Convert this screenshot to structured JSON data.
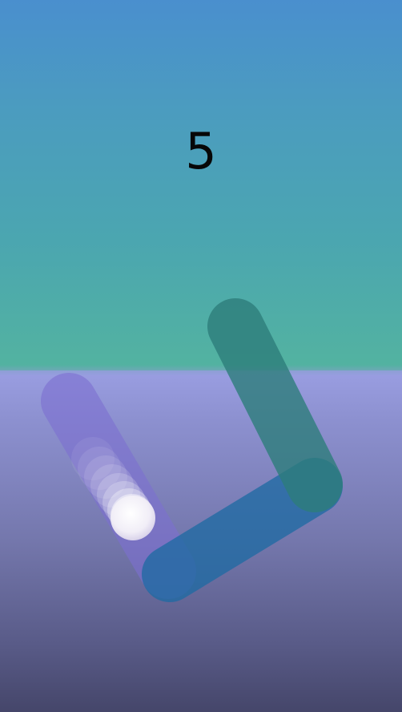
{
  "game": {
    "score": "5"
  },
  "colors": {
    "sky_top": "#4a8fce",
    "sky_bottom": "#53b3a0",
    "floor_top": "#9a9ee2",
    "floor_bottom": "#45466a",
    "path_purple": "#7d6fd0",
    "path_blue": "#1f6aa3",
    "path_teal": "#2d7d7a",
    "ball": "#ffffff"
  }
}
